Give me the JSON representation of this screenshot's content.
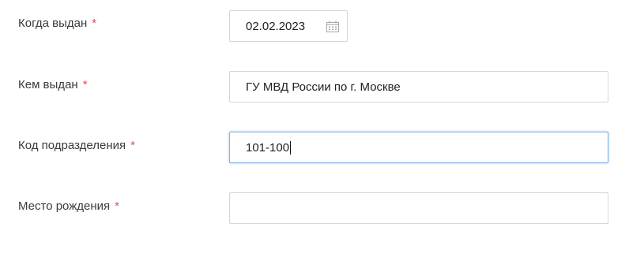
{
  "form": {
    "issue_date": {
      "label": "Когда выдан",
      "required_mark": "*",
      "value": "02.02.2023",
      "icon": "calendar-icon"
    },
    "issued_by": {
      "label": "Кем выдан",
      "required_mark": "*",
      "value": "ГУ МВД России по г. Москве"
    },
    "division_code": {
      "label": "Код подразделения",
      "required_mark": "*",
      "value": "101-100",
      "focused": true
    },
    "birth_place": {
      "label": "Место рождения",
      "required_mark": "*",
      "value": ""
    }
  },
  "colors": {
    "required": "#d9534f",
    "focus_border": "#7fb2e5",
    "field_border": "#d6d6d6"
  }
}
